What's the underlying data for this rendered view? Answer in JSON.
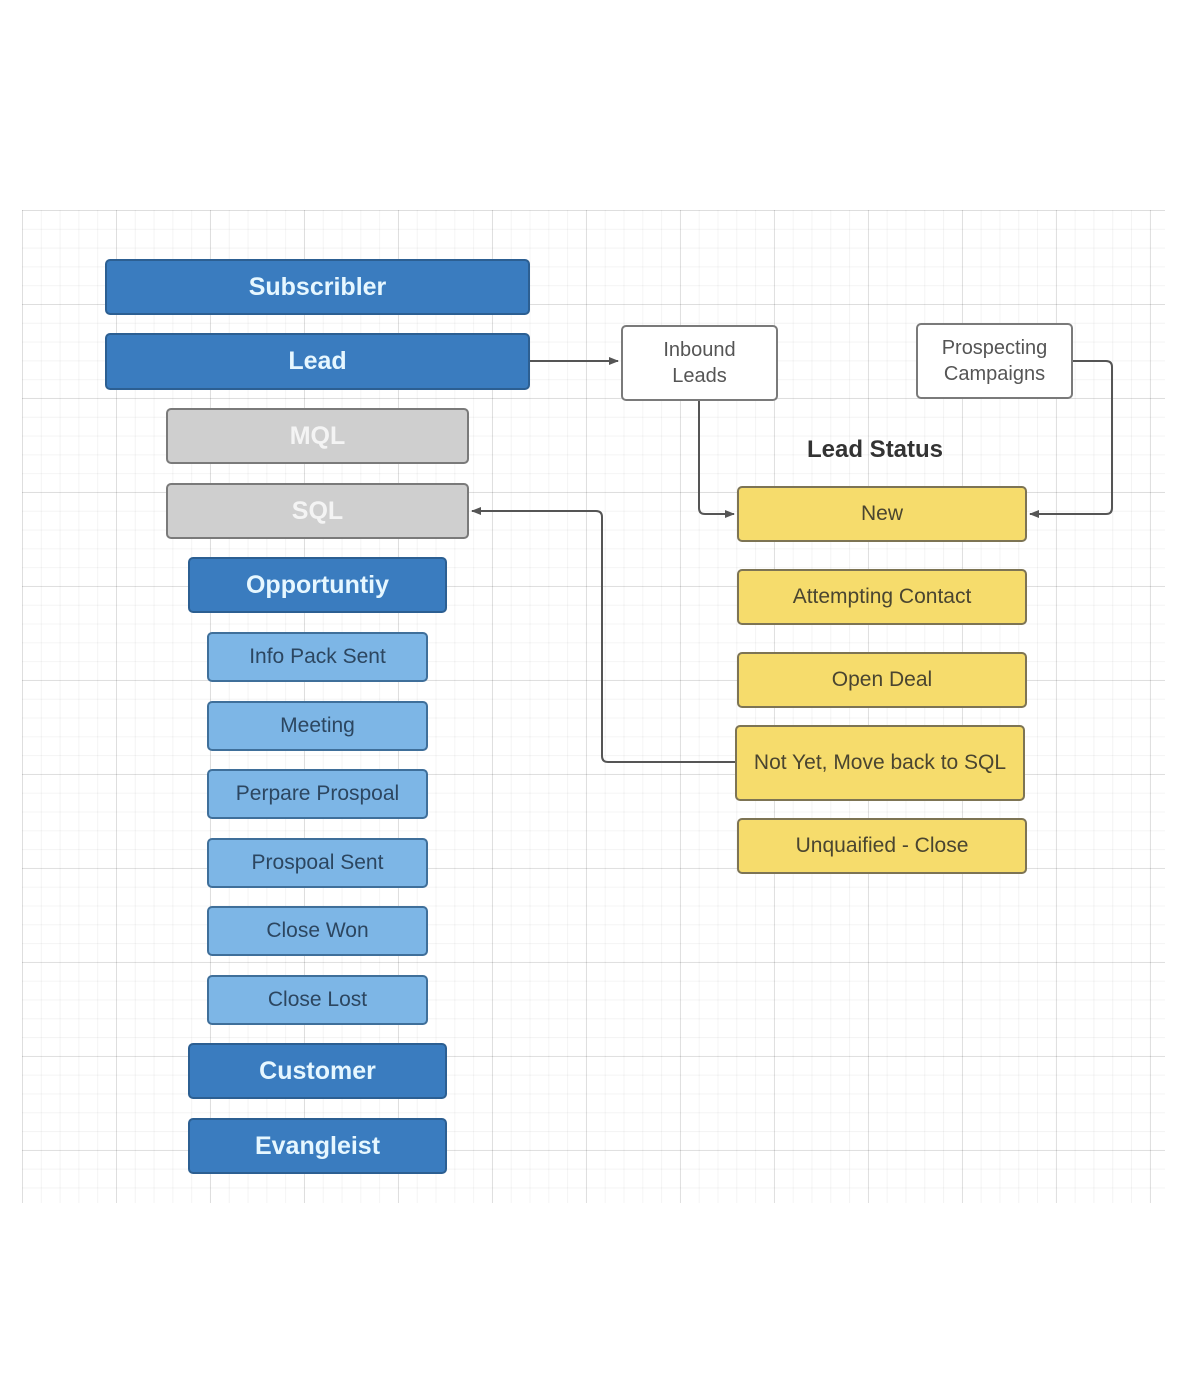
{
  "diagram": {
    "lifecycle_stages": {
      "subscriber": "Subscribler",
      "lead": "Lead",
      "mql": "MQL",
      "sql": "SQL",
      "opportunity": "Opportuntiy",
      "customer": "Customer",
      "evangelist": "Evangleist"
    },
    "opportunity_substages": [
      "Info Pack Sent",
      "Meeting",
      "Perpare Prospoal",
      "Prospoal Sent",
      "Close Won",
      "Close Lost"
    ],
    "sources": {
      "inbound": "Inbound\nLeads",
      "prospecting": "Prospecting\nCampaigns"
    },
    "lead_status": {
      "title": "Lead Status",
      "items": [
        "New",
        "Attempting Contact",
        "Open Deal",
        "Not Yet, Move back to SQL",
        "Unquaified - Close"
      ]
    },
    "connections": [
      {
        "from": "Lead",
        "to": "Inbound Leads"
      },
      {
        "from": "Inbound Leads",
        "to": "New"
      },
      {
        "from": "Prospecting Campaigns",
        "to": "New"
      },
      {
        "from": "Not Yet, Move back to SQL",
        "to": "SQL"
      }
    ],
    "colors": {
      "stage_blue": "#3a7cbf",
      "stage_grey": "#cfcfcf",
      "substage_light_blue": "#7db6e6",
      "status_yellow": "#f6dc6c",
      "connector": "#555555"
    }
  }
}
